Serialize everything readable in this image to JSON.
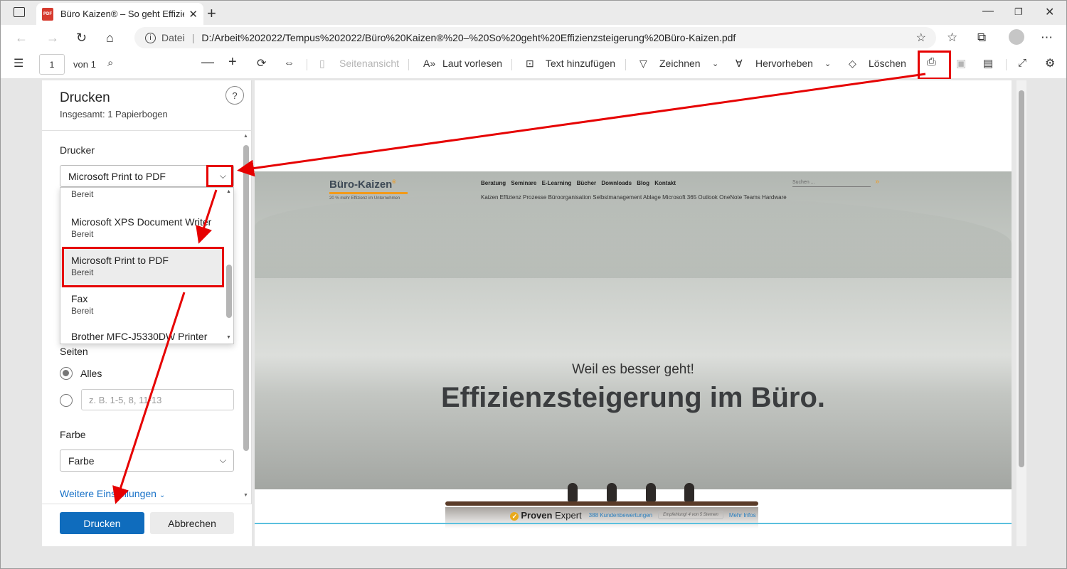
{
  "tab": {
    "title": "Büro Kaizen® – So geht Effizienz",
    "pdf_badge": "PDF"
  },
  "address": {
    "scheme_label": "Datei",
    "url": "D:/Arbeit%202022/Tempus%202022/Büro%20Kaizen®%20–%20So%20geht%20Effizienzsteigerung%20Büro-Kaizen.pdf"
  },
  "toolbar": {
    "page_number": "1",
    "page_of": "von 1",
    "page_view": "Seitenansicht",
    "read_aloud": "Laut vorlesen",
    "add_text": "Text hinzufügen",
    "draw": "Zeichnen",
    "highlight": "Hervorheben",
    "erase": "Löschen"
  },
  "print_panel": {
    "title": "Drucken",
    "summary": "Insgesamt: 1 Papierbogen",
    "printer_label": "Drucker",
    "printer_selected": "Microsoft Print to PDF",
    "pages_label": "Seiten",
    "pages_all": "Alles",
    "pages_placeholder": "z. B. 1-5, 8, 11-13",
    "color_label": "Farbe",
    "color_selected": "Farbe",
    "more_settings": "Weitere Einstellungen",
    "print_button": "Drucken",
    "cancel_button": "Abbrechen"
  },
  "printer_list": [
    {
      "name": "",
      "status": "Bereit"
    },
    {
      "name": "Microsoft XPS Document Writer",
      "status": "Bereit"
    },
    {
      "name": "Microsoft Print to PDF",
      "status": "Bereit"
    },
    {
      "name": "Fax",
      "status": "Bereit"
    },
    {
      "name": "Brother MFC-J5330DW Printer",
      "status": ""
    }
  ],
  "pdf_page": {
    "logo": "Büro-Kaizen",
    "logo_mark": "®",
    "tagline": "20 % mehr Effizienz im Unternehmen",
    "menu_primary": "Beratung Seminare E-Learning Bücher Downloads Blog Kontakt",
    "menu_secondary": "Kaizen Effizienz Prozesse Büroorganisation Selbstmanagement Ablage Microsoft 365 Outlook OneNote Teams Hardware",
    "search_placeholder": "Suchen ...",
    "subheadline": "Weil es besser geht!",
    "headline": "Effizienzsteigerung im Büro.",
    "proven_brand": "Proven",
    "proven_brand_2": "Expert",
    "reviews": "388 Kundenbewertungen",
    "recommend": "Empfehlung! 4 von 5 Sternen",
    "more_info": "Mehr Infos"
  },
  "colors": {
    "accent": "#0f6cbd",
    "annotation_red": "#e60000",
    "brand_orange": "#f29a1a"
  }
}
